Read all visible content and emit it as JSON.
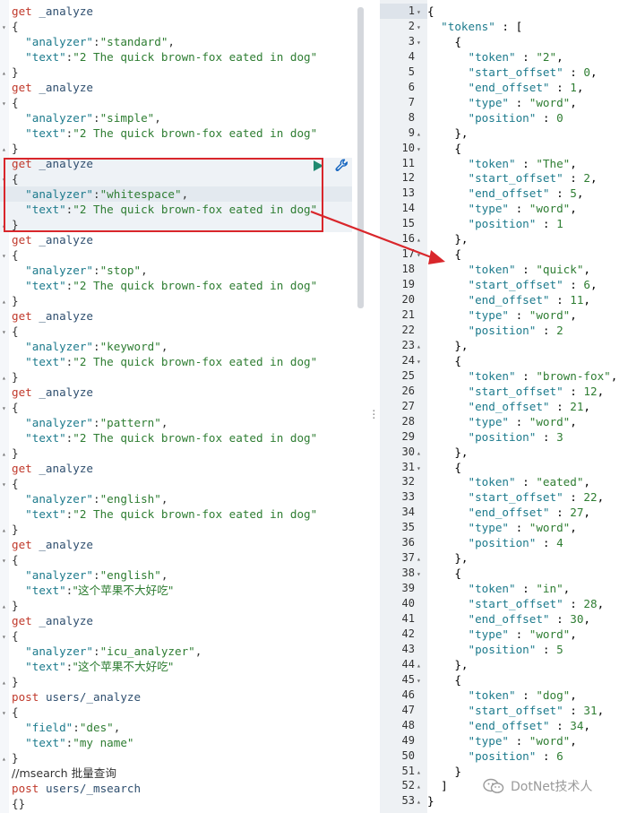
{
  "console": {
    "requests": [
      {
        "method": "get",
        "path": "_analyze",
        "analyzer_key": "\"analyzer\"",
        "analyzer": "\"standard\"",
        "text_key": "\"text\"",
        "text": "\"2 The quick brown-fox eated in dog\""
      },
      {
        "method": "get",
        "path": "_analyze",
        "analyzer_key": "\"analyzer\"",
        "analyzer": "\"simple\"",
        "text_key": "\"text\"",
        "text": "\"2 The quick brown-fox eated in dog\""
      },
      {
        "method": "get",
        "path": "_analyze",
        "analyzer_key": "\"analyzer\"",
        "analyzer": "\"whitespace\"",
        "text_key": "\"text\"",
        "text": "\"2 The quick brown-fox eated in dog\""
      },
      {
        "method": "get",
        "path": "_analyze",
        "analyzer_key": "\"analyzer\"",
        "analyzer": "\"stop\"",
        "text_key": "\"text\"",
        "text": "\"2 The quick brown-fox eated in dog\""
      },
      {
        "method": "get",
        "path": "_analyze",
        "analyzer_key": "\"analyzer\"",
        "analyzer": "\"keyword\"",
        "text_key": "\"text\"",
        "text": "\"2 The quick brown-fox eated in dog\""
      },
      {
        "method": "get",
        "path": "_analyze",
        "analyzer_key": "\"analyzer\"",
        "analyzer": "\"pattern\"",
        "text_key": "\"text\"",
        "text": "\"2 The quick brown-fox eated in dog\""
      },
      {
        "method": "get",
        "path": "_analyze",
        "analyzer_key": "\"analyzer\"",
        "analyzer": "\"english\"",
        "text_key": "\"text\"",
        "text": "\"2 The quick brown-fox eated in dog\""
      },
      {
        "method": "get",
        "path": "_analyze",
        "analyzer_key": "\"analyzer\"",
        "analyzer": "\"english\"",
        "text_key": "\"text\"",
        "text": "\"这个苹果不大好吃\""
      },
      {
        "method": "get",
        "path": "_analyze",
        "analyzer_key": "\"analyzer\"",
        "analyzer": "\"icu_analyzer\"",
        "text_key": "\"text\"",
        "text": "\"这个苹果不大好吃\""
      },
      {
        "method": "post",
        "path": "users/_analyze",
        "analyzer_key": "\"field\"",
        "analyzer": "\"des\"",
        "text_key": "\"text\"",
        "text": "\"my name\""
      }
    ],
    "comment": "//msearch 批量查询",
    "last_request": {
      "method": "post",
      "path": "users/_msearch",
      "body": "{}"
    }
  },
  "response": {
    "lines": [
      "{",
      "  \"tokens\" : [",
      "    {",
      "      \"token\" : \"2\",",
      "      \"start_offset\" : 0,",
      "      \"end_offset\" : 1,",
      "      \"type\" : \"word\",",
      "      \"position\" : 0",
      "    },",
      "    {",
      "      \"token\" : \"The\",",
      "      \"start_offset\" : 2,",
      "      \"end_offset\" : 5,",
      "      \"type\" : \"word\",",
      "      \"position\" : 1",
      "    },",
      "    {",
      "      \"token\" : \"quick\",",
      "      \"start_offset\" : 6,",
      "      \"end_offset\" : 11,",
      "      \"type\" : \"word\",",
      "      \"position\" : 2",
      "    },",
      "    {",
      "      \"token\" : \"brown-fox\",",
      "      \"start_offset\" : 12,",
      "      \"end_offset\" : 21,",
      "      \"type\" : \"word\",",
      "      \"position\" : 3",
      "    },",
      "    {",
      "      \"token\" : \"eated\",",
      "      \"start_offset\" : 22,",
      "      \"end_offset\" : 27,",
      "      \"type\" : \"word\",",
      "      \"position\" : 4",
      "    },",
      "    {",
      "      \"token\" : \"in\",",
      "      \"start_offset\" : 28,",
      "      \"end_offset\" : 30,",
      "      \"type\" : \"word\",",
      "      \"position\" : 5",
      "    },",
      "    {",
      "      \"token\" : \"dog\",",
      "      \"start_offset\" : 31,",
      "      \"end_offset\" : 34,",
      "      \"type\" : \"word\",",
      "      \"position\" : 6",
      "    }",
      "  ]",
      "}"
    ],
    "fold_lines": [
      1,
      2,
      3,
      9,
      10,
      16,
      17,
      23,
      24,
      30,
      31,
      37,
      38,
      44,
      45,
      51,
      52,
      53
    ]
  },
  "watermark": {
    "text": "DotNet技术人"
  },
  "colors": {
    "highlight": "#d9262b",
    "run": "#1f8a70",
    "wrench": "#1565c0"
  }
}
